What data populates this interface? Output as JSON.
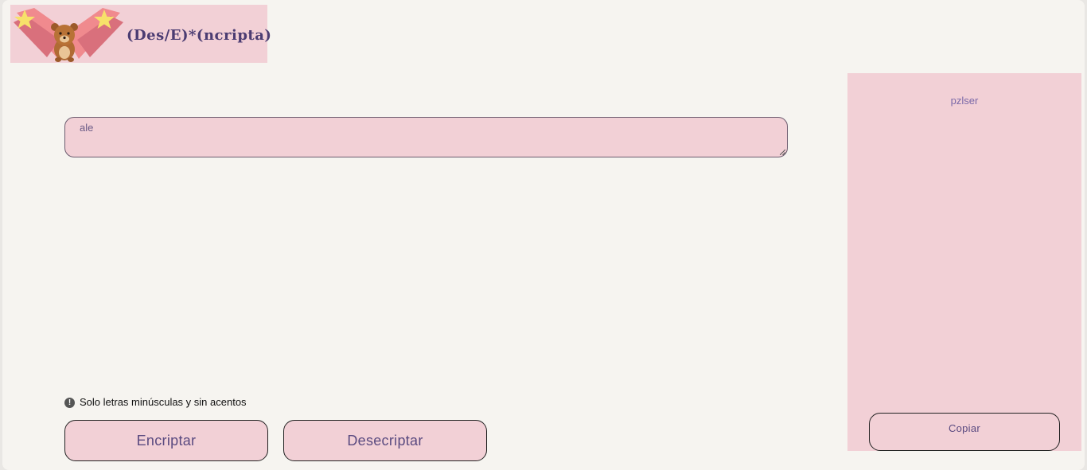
{
  "header": {
    "logo_title": "(Des/E)*(ncripta)",
    "logo_icon": "teddy-bear-with-stars"
  },
  "encrypt_panel": {
    "input_value": "ale",
    "hint_icon": "info-icon",
    "hint_text": "Solo letras minúsculas y sin acentos",
    "encrypt_label": "Encriptar",
    "decrypt_label": "Desecriptar"
  },
  "output_panel": {
    "result_text": "pzlser",
    "copy_label": "Copiar"
  },
  "colors": {
    "panel_pink": "#f2d0d6",
    "text_purple": "#5a4a80",
    "page_bg": "#f6f4f0"
  }
}
